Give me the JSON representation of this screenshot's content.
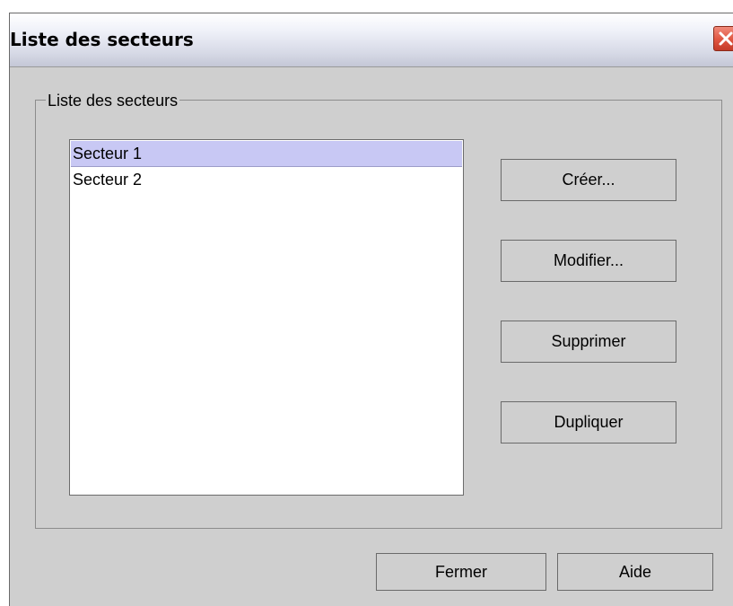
{
  "window": {
    "title": "Liste des secteurs",
    "close_icon": "close-icon"
  },
  "group": {
    "legend": "Liste des secteurs"
  },
  "list": {
    "items": [
      {
        "label": "Secteur 1",
        "selected": true
      },
      {
        "label": "Secteur 2",
        "selected": false
      }
    ]
  },
  "buttons": {
    "create": "Créer...",
    "modify": "Modifier...",
    "delete": "Supprimer",
    "duplicate": "Dupliquer",
    "close": "Fermer",
    "help": "Aide"
  },
  "colors": {
    "selection": "#c8c8f4",
    "close_button": "#e05540",
    "panel": "#cfcfcf"
  }
}
